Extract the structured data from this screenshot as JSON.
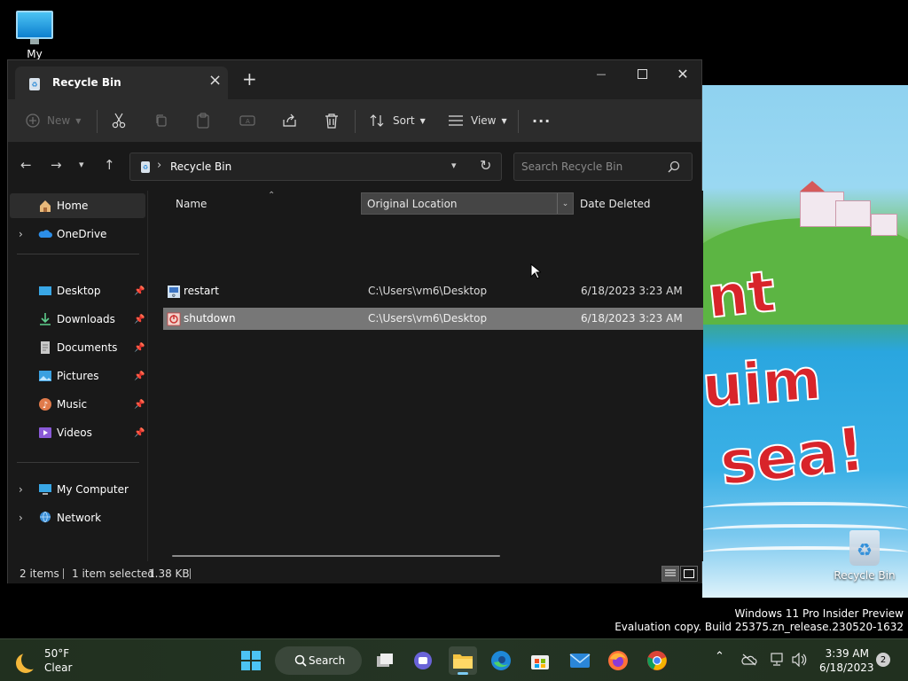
{
  "desktop": {
    "my_computer_label": "My Computer",
    "recycle_bin_label": "Recycle Bin",
    "watermark_line1": "Windows 11 Pro Insider Preview",
    "watermark_line2": "Evaluation copy. Build 25375.zn_release.230520-1632"
  },
  "window": {
    "tab_title": "Recycle Bin",
    "close_tab_glyph": "×",
    "new_tab_glyph": "+",
    "minimize_glyph": "—",
    "close_glyph": "✕"
  },
  "toolbar": {
    "new_label": "New",
    "sort_label": "Sort",
    "view_label": "View",
    "more_glyph": "···"
  },
  "address": {
    "crumb_separator": "›",
    "current_folder": "Recycle Bin",
    "search_placeholder": "Search Recycle Bin"
  },
  "nav": {
    "items": [
      {
        "label": "Home"
      },
      {
        "label": "OneDrive"
      },
      {
        "label": "Desktop"
      },
      {
        "label": "Downloads"
      },
      {
        "label": "Documents"
      },
      {
        "label": "Pictures"
      },
      {
        "label": "Music"
      },
      {
        "label": "Videos"
      },
      {
        "label": "My Computer"
      },
      {
        "label": "Network"
      }
    ]
  },
  "columns": {
    "name": "Name",
    "original_location": "Original Location",
    "date_deleted": "Date Deleted"
  },
  "files": [
    {
      "name": "restart",
      "location": "C:\\Users\\vm6\\Desktop",
      "date": "6/18/2023 3:23 AM"
    },
    {
      "name": "shutdown",
      "location": "C:\\Users\\vm6\\Desktop",
      "date": "6/18/2023 3:23 AM"
    }
  ],
  "status": {
    "item_count": "2 items",
    "selection": "1 item selected",
    "size": "1.38 KB"
  },
  "taskbar": {
    "temperature": "50°F",
    "condition": "Clear",
    "search_label": "Search",
    "time": "3:39 AM",
    "date": "6/18/2023",
    "notification_count": "2"
  },
  "colors": {
    "window_bg": "#191919",
    "toolbar_bg": "#2c2c2c",
    "selected_row": "#777777",
    "accent_blue": "#4cc3f3"
  }
}
